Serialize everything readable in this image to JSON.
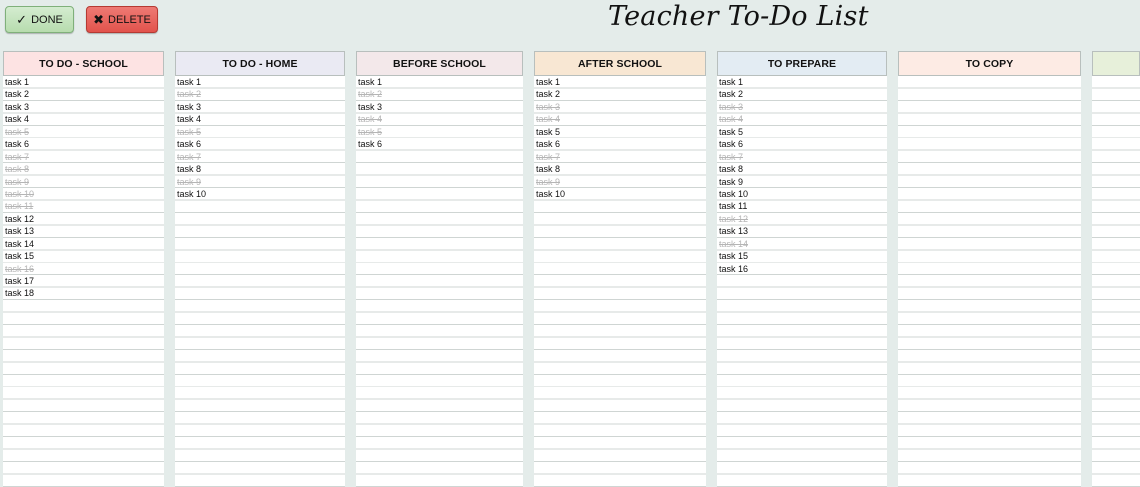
{
  "toolbar": {
    "done_label": "DONE",
    "delete_label": "DELETE",
    "done_icon": "checkmark-icon",
    "delete_icon": "x-icon"
  },
  "title": "Teacher To-Do List",
  "colors": {
    "background": "#e4ecea",
    "done_text": "#b5b5b5"
  },
  "columns": [
    {
      "header": "TO DO - SCHOOL",
      "color": "#fde3e3",
      "tasks": [
        {
          "text": "task 1",
          "done": false
        },
        {
          "text": "task 2",
          "done": false
        },
        {
          "text": "task 3",
          "done": false
        },
        {
          "text": "task 4",
          "done": false
        },
        {
          "text": "task 5",
          "done": true
        },
        {
          "text": "task 6",
          "done": false
        },
        {
          "text": "task 7",
          "done": true
        },
        {
          "text": "task 8",
          "done": true
        },
        {
          "text": "task 9",
          "done": true
        },
        {
          "text": "task 10",
          "done": true
        },
        {
          "text": "task 11",
          "done": true
        },
        {
          "text": "task 12",
          "done": false
        },
        {
          "text": "task 13",
          "done": false
        },
        {
          "text": "task 14",
          "done": false
        },
        {
          "text": "task 15",
          "done": false
        },
        {
          "text": "task 16",
          "done": true
        },
        {
          "text": "task 17",
          "done": false
        },
        {
          "text": "task 18",
          "done": false
        }
      ]
    },
    {
      "header": "TO DO - HOME",
      "color": "#eaeaf3",
      "tasks": [
        {
          "text": "task 1",
          "done": false
        },
        {
          "text": "task 2",
          "done": true
        },
        {
          "text": "task 3",
          "done": false
        },
        {
          "text": "task 4",
          "done": false
        },
        {
          "text": "task 5",
          "done": true
        },
        {
          "text": "task 6",
          "done": false
        },
        {
          "text": "task 7",
          "done": true
        },
        {
          "text": "task 8",
          "done": false
        },
        {
          "text": "task 9",
          "done": true
        },
        {
          "text": "task 10",
          "done": false
        }
      ]
    },
    {
      "header": "BEFORE SCHOOL",
      "color": "#f3e8ea",
      "tasks": [
        {
          "text": "task 1",
          "done": false
        },
        {
          "text": "task 2",
          "done": true
        },
        {
          "text": "task 3",
          "done": false
        },
        {
          "text": "task 4",
          "done": true
        },
        {
          "text": "task 5",
          "done": true
        },
        {
          "text": "task 6",
          "done": false
        }
      ]
    },
    {
      "header": "AFTER SCHOOL",
      "color": "#f8e7d3",
      "tasks": [
        {
          "text": "task 1",
          "done": false
        },
        {
          "text": "task 2",
          "done": false
        },
        {
          "text": "task 3",
          "done": true
        },
        {
          "text": "task 4",
          "done": true
        },
        {
          "text": "task 5",
          "done": false
        },
        {
          "text": "task 6",
          "done": false
        },
        {
          "text": "task 7",
          "done": true
        },
        {
          "text": "task 8",
          "done": false
        },
        {
          "text": "task 9",
          "done": true
        },
        {
          "text": "task 10",
          "done": false
        }
      ]
    },
    {
      "header": "TO PREPARE",
      "color": "#e3ecf3",
      "tasks": [
        {
          "text": "task 1",
          "done": false
        },
        {
          "text": "task 2",
          "done": false
        },
        {
          "text": "task 3",
          "done": true
        },
        {
          "text": "task 4",
          "done": true
        },
        {
          "text": "task 5",
          "done": false
        },
        {
          "text": "task 6",
          "done": false
        },
        {
          "text": "task 7",
          "done": true
        },
        {
          "text": "task 8",
          "done": false
        },
        {
          "text": "task 9",
          "done": false
        },
        {
          "text": "task 10",
          "done": false
        },
        {
          "text": "task 11",
          "done": false
        },
        {
          "text": "task 12",
          "done": true
        },
        {
          "text": "task 13",
          "done": false
        },
        {
          "text": "task 14",
          "done": true
        },
        {
          "text": "task 15",
          "done": false
        },
        {
          "text": "task 16",
          "done": false
        }
      ]
    },
    {
      "header": "TO COPY",
      "color": "#fdebe4",
      "tasks": []
    },
    {
      "header": "",
      "color": "#e7f0da",
      "tasks": []
    }
  ]
}
